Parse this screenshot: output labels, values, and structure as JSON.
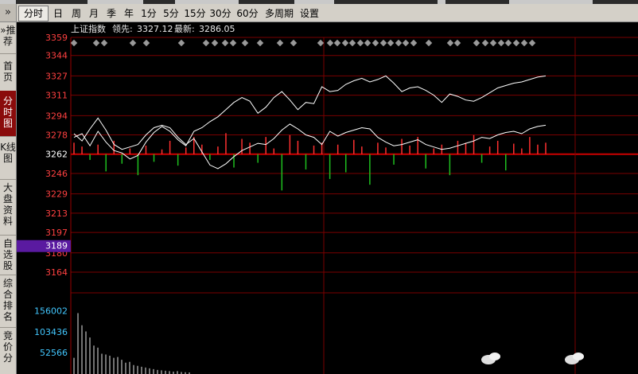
{
  "toolbar": {
    "items": [
      {
        "label": "分时",
        "active": true
      },
      {
        "label": "日"
      },
      {
        "label": "周"
      },
      {
        "label": "月"
      },
      {
        "label": "季"
      },
      {
        "label": "年"
      },
      {
        "label": "1分"
      },
      {
        "label": "5分"
      },
      {
        "label": "15分"
      },
      {
        "label": "30分"
      },
      {
        "label": "60分"
      },
      {
        "label": "多周期"
      },
      {
        "label": "设置"
      }
    ]
  },
  "sidebar": {
    "items": [
      {
        "label": "»推荐"
      },
      {
        "label": "首页"
      },
      {
        "label": "分时图",
        "active": true
      },
      {
        "label": "K线图"
      },
      {
        "label": "大盘资料"
      },
      {
        "label": "自选股"
      },
      {
        "label": "综合排名"
      },
      {
        "label": "竞价分"
      }
    ]
  },
  "info": {
    "index_name": "上证指数",
    "leader_label": "领先:",
    "leader_value": "3327.12",
    "latest_label": "最新:",
    "latest_value": "3286.05"
  },
  "chart_data": [
    {
      "type": "line",
      "title": "上证指数",
      "y_ticks": [
        3359,
        3344,
        3327,
        3311,
        3294,
        3278,
        3262,
        3246,
        3229,
        3213,
        3197,
        3180,
        3164
      ],
      "prev_close": 3262,
      "highlight_label": "3189",
      "ylim": [
        3164,
        3359
      ],
      "series": [
        {
          "name": "领先",
          "color": "#ffffff",
          "values": [
            3276,
            3279,
            3269,
            3281,
            3272,
            3265,
            3263,
            3258,
            3261,
            3272,
            3280,
            3285,
            3281,
            3274,
            3269,
            3281,
            3284,
            3289,
            3293,
            3299,
            3305,
            3309,
            3306,
            3296,
            3301,
            3309,
            3314,
            3307,
            3299,
            3305,
            3304,
            3318,
            3314,
            3315,
            3320,
            3323,
            3325,
            3322,
            3324,
            3327,
            3321,
            3314,
            3317,
            3318,
            3315,
            3311,
            3305,
            3312,
            3310,
            3307,
            3306,
            3309,
            3313,
            3317,
            3319,
            3321,
            3322,
            3324,
            3326,
            3327
          ]
        },
        {
          "name": "最新",
          "color": "#ffffff",
          "values": [
            3279,
            3273,
            3283,
            3292,
            3282,
            3270,
            3266,
            3268,
            3270,
            3278,
            3284,
            3286,
            3284,
            3276,
            3270,
            3275,
            3264,
            3253,
            3250,
            3254,
            3260,
            3265,
            3268,
            3271,
            3270,
            3275,
            3282,
            3287,
            3283,
            3278,
            3276,
            3270,
            3281,
            3277,
            3280,
            3282,
            3284,
            3283,
            3276,
            3272,
            3269,
            3270,
            3272,
            3274,
            3270,
            3268,
            3266,
            3267,
            3269,
            3271,
            3273,
            3276,
            3275,
            3278,
            3280,
            3281,
            3279,
            3283,
            3285,
            3286
          ]
        }
      ],
      "bars": [
        12,
        8,
        -6,
        10,
        -18,
        14,
        -10,
        6,
        -22,
        9,
        -8,
        5,
        14,
        -12,
        7,
        18,
        10,
        -6,
        8,
        22,
        -14,
        16,
        12,
        -9,
        18,
        6,
        -38,
        20,
        14,
        -16,
        9,
        12,
        -26,
        10,
        -19,
        15,
        8,
        -32,
        12,
        7,
        -11,
        16,
        9,
        18,
        -15,
        6,
        10,
        -22,
        14,
        12,
        20,
        -9,
        8,
        14,
        -17,
        11,
        6,
        18,
        10,
        12
      ]
    },
    {
      "type": "bar",
      "title": "",
      "y_ticks": [
        156002,
        103436,
        52566
      ],
      "values": [
        40000,
        150000,
        120000,
        105000,
        90000,
        70000,
        65000,
        50000,
        48000,
        45000,
        40000,
        42000,
        35000,
        28000,
        30000,
        22000,
        20000,
        18000,
        16000,
        14000,
        12000,
        10000,
        9000,
        8000,
        7000,
        6000,
        7000,
        5000,
        4500,
        4000
      ]
    }
  ],
  "colors": {
    "up": "#ff3030",
    "down": "#1fbf1f",
    "axis_label": "#ff4040",
    "vol_label": "#42c7ff",
    "grid": "#7a0000",
    "highlight_bg": "#5a1aa0"
  }
}
